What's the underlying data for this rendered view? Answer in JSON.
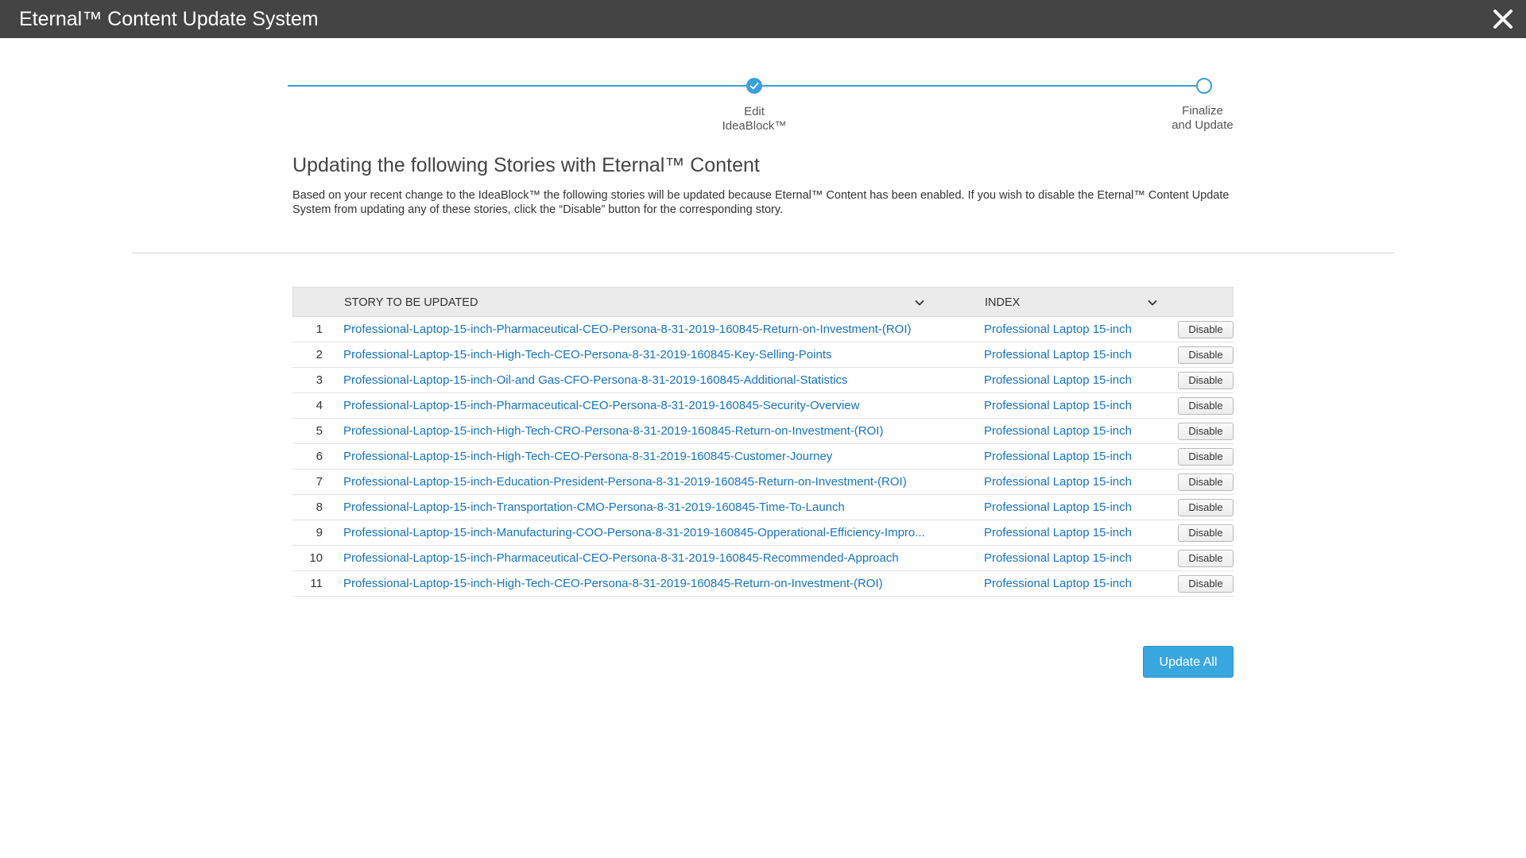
{
  "window": {
    "title": "Eternal™ Content Update System",
    "close_icon": "close-icon"
  },
  "stepper": {
    "steps": [
      {
        "label": "Edit IdeaBlock™",
        "state": "completed"
      },
      {
        "label": "Finalize and Update",
        "state": "pending"
      }
    ]
  },
  "main": {
    "heading": "Updating the following Stories with Eternal™ Content",
    "description": "Based on your recent change to the IdeaBlock™ the following stories will be updated because Eternal™ Content has been enabled.  If you wish to disable the Eternal™ Content Update System from updating any of these stories, click the “Disable” button for the corresponding story."
  },
  "table": {
    "columns": {
      "story": "STORY TO BE UPDATED",
      "index": "INDEX"
    },
    "disable_label": "Disable",
    "rows": [
      {
        "num": "1",
        "story": "Professional-Laptop-15-inch-Pharmaceutical-CEO-Persona-8-31-2019-160845-Return-on-Investment-(ROI)",
        "index": "Professional Laptop 15-inch"
      },
      {
        "num": "2",
        "story": "Professional-Laptop-15-inch-High-Tech-CEO-Persona-8-31-2019-160845-Key-Selling-Points",
        "index": "Professional Laptop 15-inch"
      },
      {
        "num": "3",
        "story": "Professional-Laptop-15-inch-Oil-and Gas-CFO-Persona-8-31-2019-160845-Additional-Statistics",
        "index": "Professional Laptop 15-inch"
      },
      {
        "num": "4",
        "story": "Professional-Laptop-15-inch-Pharmaceutical-CEO-Persona-8-31-2019-160845-Security-Overview",
        "index": "Professional Laptop 15-inch"
      },
      {
        "num": "5",
        "story": "Professional-Laptop-15-inch-High-Tech-CRO-Persona-8-31-2019-160845-Return-on-Investment-(ROI)",
        "index": "Professional Laptop 15-inch"
      },
      {
        "num": "6",
        "story": "Professional-Laptop-15-inch-High-Tech-CEO-Persona-8-31-2019-160845-Customer-Journey",
        "index": "Professional Laptop 15-inch"
      },
      {
        "num": "7",
        "story": "Professional-Laptop-15-inch-Education-President-Persona-8-31-2019-160845-Return-on-Investment-(ROI)",
        "index": "Professional Laptop 15-inch"
      },
      {
        "num": "8",
        "story": "Professional-Laptop-15-inch-Transportation-CMO-Persona-8-31-2019-160845-Time-To-Launch",
        "index": "Professional Laptop 15-inch"
      },
      {
        "num": "9",
        "story": "Professional-Laptop-15-inch-Manufacturing-COO-Persona-8-31-2019-160845-Opperational-Efficiency-Impro...",
        "index": "Professional Laptop 15-inch"
      },
      {
        "num": "10",
        "story": "Professional-Laptop-15-inch-Pharmaceutical-CEO-Persona-8-31-2019-160845-Recommended-Approach",
        "index": "Professional Laptop 15-inch"
      },
      {
        "num": "11",
        "story": "Professional-Laptop-15-inch-High-Tech-CEO-Persona-8-31-2019-160845-Return-on-Investment-(ROI)",
        "index": "Professional Laptop 15-inch"
      }
    ]
  },
  "footer": {
    "update_all_label": "Update All"
  },
  "colors": {
    "titlebar": "#444444",
    "accent": "#3b9fd8",
    "link": "#1673c6",
    "button_primary": "#3aa8e0"
  }
}
